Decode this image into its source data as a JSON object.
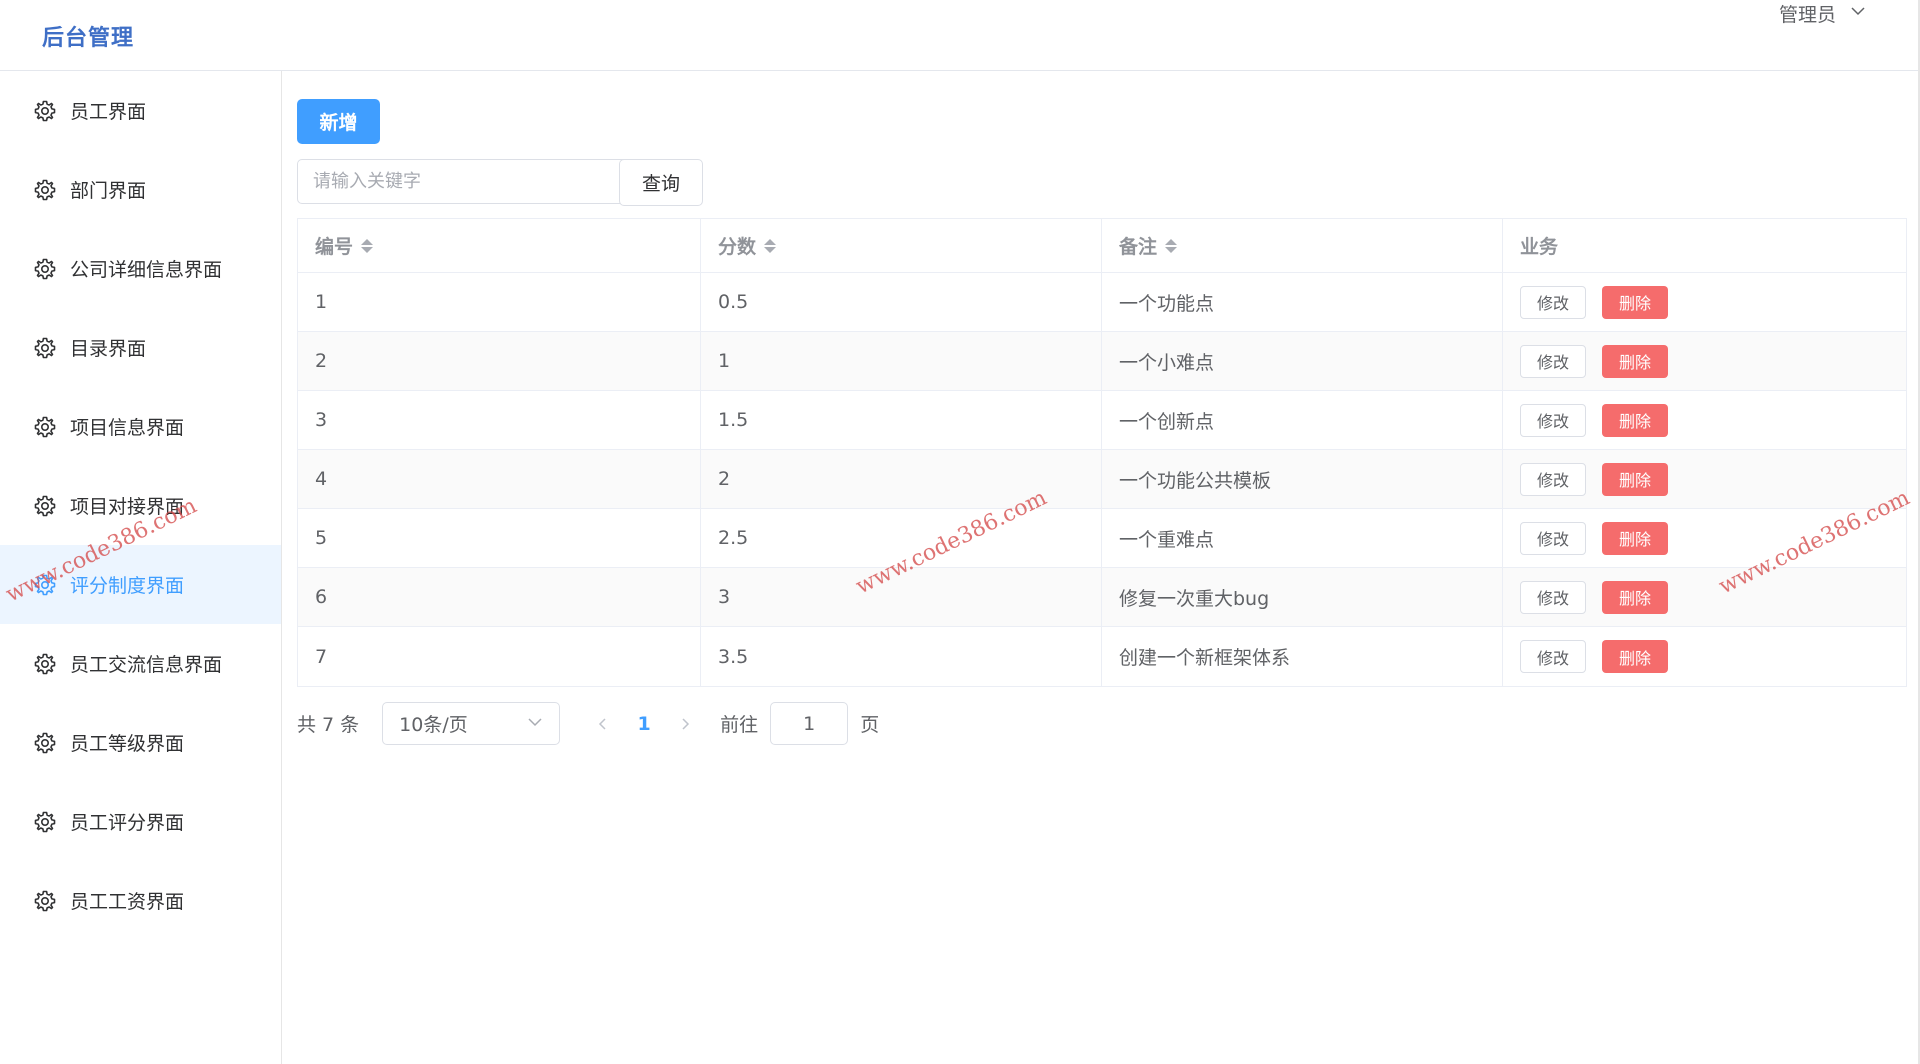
{
  "header": {
    "brand": "后台管理",
    "user": "管理员",
    "user_icon": "chevron-down-icon"
  },
  "sidebar": {
    "items": [
      {
        "label": "员工界面",
        "icon": "gear-icon",
        "active": false
      },
      {
        "label": "部门界面",
        "icon": "gear-icon",
        "active": false
      },
      {
        "label": "公司详细信息界面",
        "icon": "gear-icon",
        "active": false
      },
      {
        "label": "目录界面",
        "icon": "gear-icon",
        "active": false
      },
      {
        "label": "项目信息界面",
        "icon": "gear-icon",
        "active": false
      },
      {
        "label": "项目对接界面",
        "icon": "gear-icon",
        "active": false
      },
      {
        "label": "评分制度界面",
        "icon": "gear-icon",
        "active": true
      },
      {
        "label": "员工交流信息界面",
        "icon": "gear-icon",
        "active": false
      },
      {
        "label": "员工等级界面",
        "icon": "gear-icon",
        "active": false
      },
      {
        "label": "员工评分界面",
        "icon": "gear-icon",
        "active": false
      },
      {
        "label": "员工工资界面",
        "icon": "gear-icon",
        "active": false
      }
    ]
  },
  "toolbar": {
    "add_label": "新增",
    "search_placeholder": "请输入关键字",
    "search_value": "",
    "query_label": "查询"
  },
  "table": {
    "columns": [
      "编号",
      "分数",
      "备注",
      "业务"
    ],
    "edit_label": "修改",
    "delete_label": "删除",
    "rows": [
      {
        "id": "1",
        "score": "0.5",
        "note": "一个功能点"
      },
      {
        "id": "2",
        "score": "1",
        "note": "一个小难点"
      },
      {
        "id": "3",
        "score": "1.5",
        "note": "一个创新点"
      },
      {
        "id": "4",
        "score": "2",
        "note": "一个功能公共模板"
      },
      {
        "id": "5",
        "score": "2.5",
        "note": "一个重难点"
      },
      {
        "id": "6",
        "score": "3",
        "note": "修复一次重大bug"
      },
      {
        "id": "7",
        "score": "3.5",
        "note": "创建一个新框架体系"
      }
    ]
  },
  "pagination": {
    "total_text": "共 7 条",
    "page_size": "10条/页",
    "current_page": "1",
    "goto_prefix": "前往",
    "goto_value": "1",
    "goto_suffix": "页"
  },
  "watermark": "www.code386.com",
  "colors": {
    "primary": "#409eff",
    "danger": "#f56c6c",
    "brand": "#3f6fc6",
    "active_bg": "#ecf5ff"
  }
}
